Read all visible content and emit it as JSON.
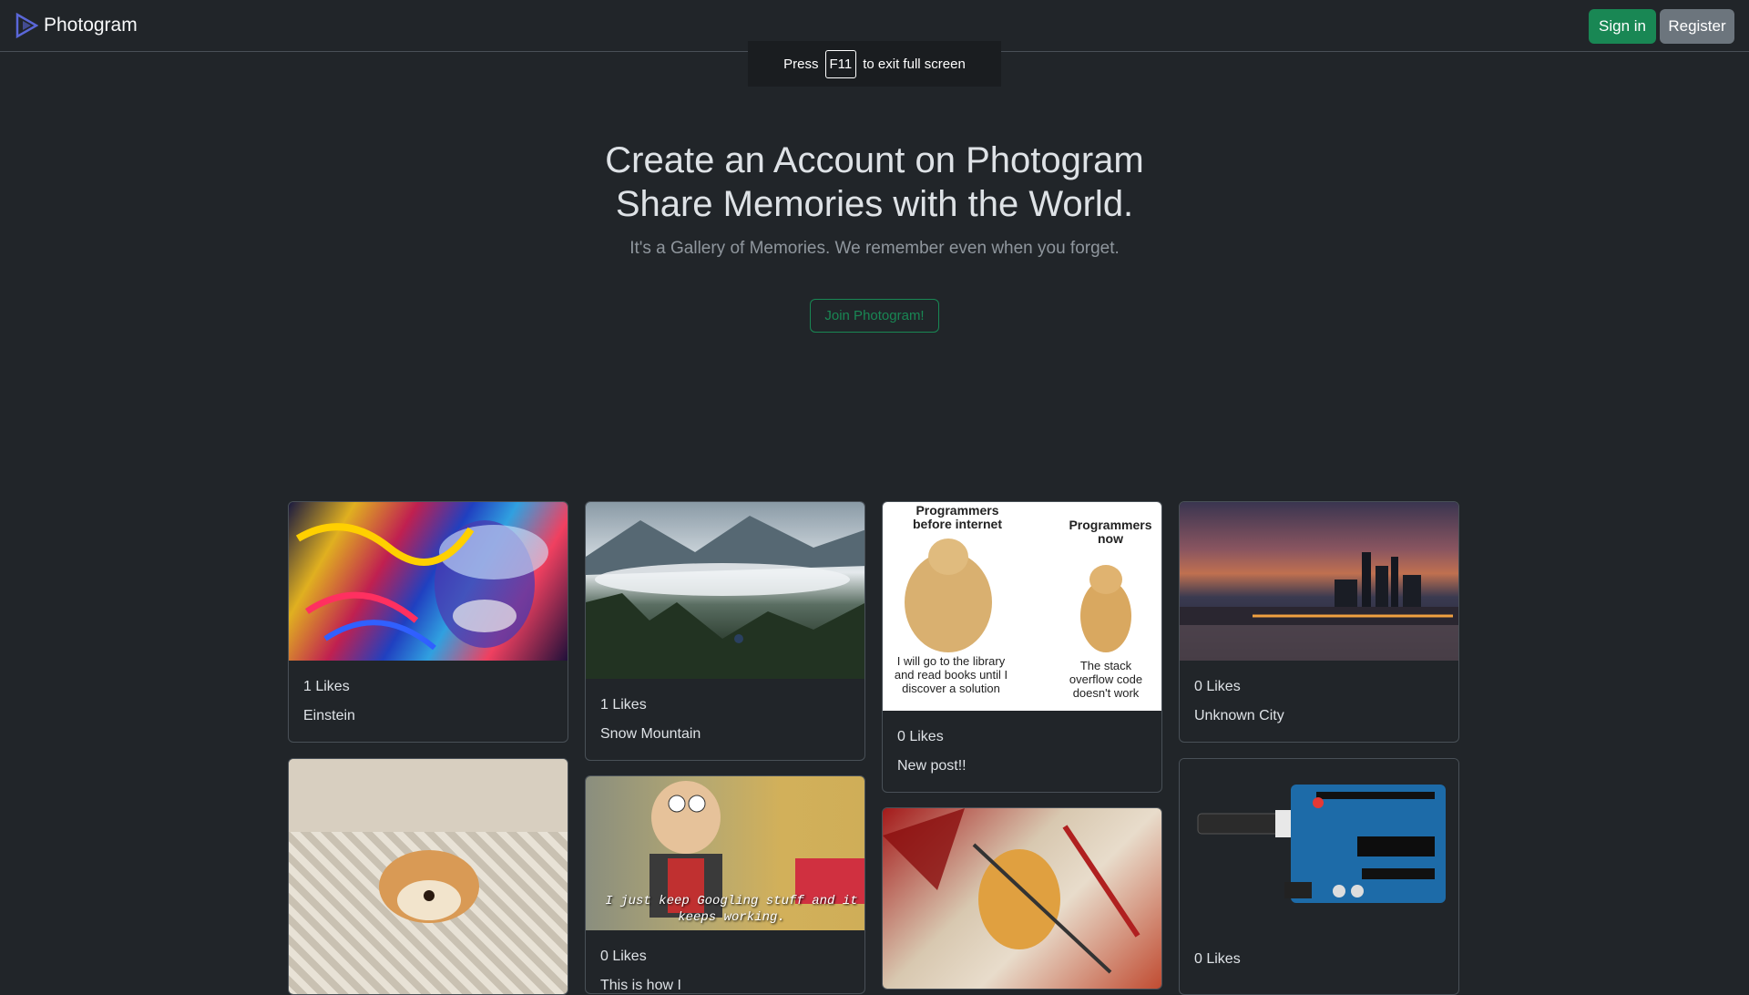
{
  "nav": {
    "brand": "Photogram",
    "signin_label": "Sign in",
    "register_label": "Register"
  },
  "toast": {
    "press": "Press",
    "key": "F11",
    "suffix": "to exit full screen"
  },
  "hero": {
    "line1": "Create an Account on Photogram",
    "line2": "Share Memories with the World.",
    "subtitle": "It's a Gallery of Memories. We remember even when you forget.",
    "join_label": "Join Photogram!"
  },
  "posts": [
    {
      "likes": "1 Likes",
      "caption": "Einstein"
    },
    {
      "likes": "1 Likes",
      "caption": "Snow Mountain"
    },
    {
      "likes": "0 Likes",
      "caption": "New post!!"
    },
    {
      "likes": "0 Likes",
      "caption": "Unknown City"
    },
    {
      "likes": "",
      "caption": ""
    },
    {
      "likes": "0 Likes",
      "caption": "This is how I"
    },
    {
      "likes": "",
      "caption": ""
    },
    {
      "likes": "0 Likes",
      "caption": ""
    }
  ],
  "meme": {
    "left_title": "Programmers before internet",
    "right_title": "Programmers now",
    "left_caption": "I will go to the library and read books until I discover a solution",
    "right_caption": "The stack overflow code doesn't work"
  },
  "rick_caption": "I just keep Googling stuff and it keeps working.",
  "colors": {
    "background": "#212529",
    "success": "#198754",
    "secondary": "#6c757d",
    "border": "#495057"
  }
}
